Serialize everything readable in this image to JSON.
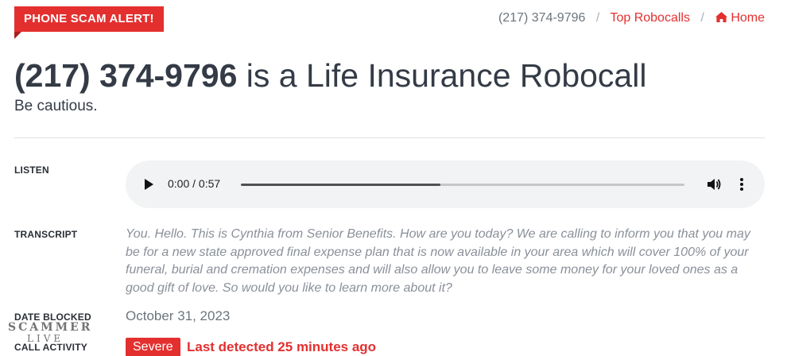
{
  "badge": {
    "label": "PHONE SCAM ALERT!"
  },
  "breadcrumb": {
    "current": "(217) 374-9796",
    "top_robocalls": "Top Robocalls",
    "home": "Home",
    "separator": "/"
  },
  "heading": {
    "number": "(217) 374-9796",
    "rest": " is a Life Insurance Robocall",
    "subtitle": "Be cautious."
  },
  "listen": {
    "label": "LISTEN",
    "time": "0:00 / 0:57",
    "progress": 0.45
  },
  "transcript": {
    "label": "TRANSCRIPT",
    "text": "You. Hello. This is Cynthia from Senior Benefits. How are you today? We are calling to inform you that you may be for a new state approved final expense plan that is now available in your area which will cover 100% of your funeral, burial and cremation expenses and will also allow you to leave some money for your loved ones as a good gift of love. So would you like to learn more about it?"
  },
  "date_blocked": {
    "label": "DATE BLOCKED",
    "value": "October 31, 2023"
  },
  "call_activity": {
    "label": "CALL ACTIVITY",
    "severity": "Severe",
    "last_detected": "Last detected 25 minutes ago"
  },
  "watermark": {
    "line1": "SCAMMER",
    "line2": "LIVE"
  },
  "colors": {
    "accent": "#e3302f",
    "text": "#343b46",
    "muted": "#8a9099"
  }
}
